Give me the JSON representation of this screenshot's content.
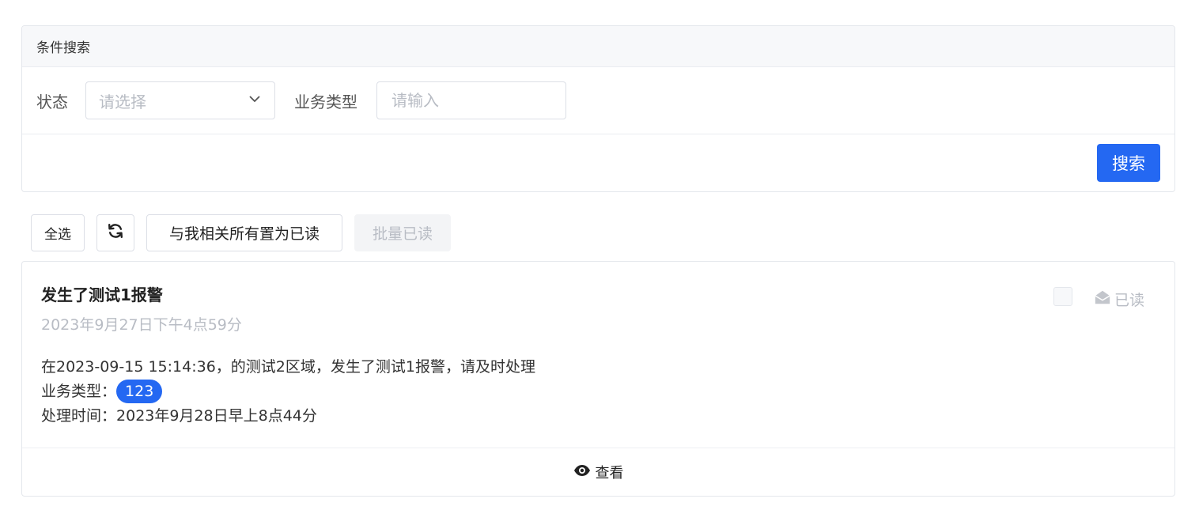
{
  "search": {
    "header": "条件搜索",
    "status_label": "状态",
    "status_placeholder": "请选择",
    "type_label": "业务类型",
    "type_placeholder": "请输入",
    "search_button": "搜索"
  },
  "toolbar": {
    "select_all": "全选",
    "mark_all_read": "与我相关所有置为已读",
    "batch_read": "批量已读"
  },
  "message": {
    "title": "发生了测试1报警",
    "date": "2023年9月27日下午4点59分",
    "content_line": "在2023-09-15 15:14:36，的测试2区域，发生了测试1报警，请及时处理",
    "type_label": "业务类型：",
    "type_value": "123",
    "handle_label": "处理时间：",
    "handle_time": "2023年9月28日早上8点44分",
    "read_status": "已读",
    "view_label": "查看"
  },
  "colors": {
    "primary": "#2468f2",
    "muted": "#b8bcc4"
  }
}
